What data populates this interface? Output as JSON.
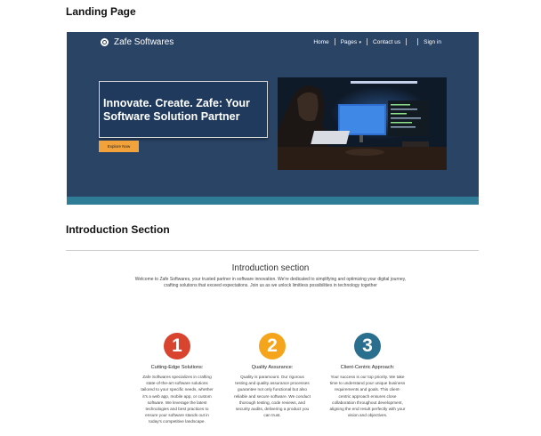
{
  "page": {
    "title": "Landing Page"
  },
  "hero": {
    "brand": "Zafe Softwares",
    "nav": {
      "home": "Home",
      "pages": "Pages",
      "contact": "Contact us",
      "signin": "Sign in"
    },
    "headline": "Innovate. Create. Zafe: Your Software Solution Partner",
    "cta": "Explore Now",
    "image_icon": "workspace-photo",
    "colors": {
      "background": "#2a4466",
      "strip": "#2f7c97",
      "cta": "#f2a23a"
    }
  },
  "intro": {
    "heading": "Introduction Section",
    "subheading": "Introduction section",
    "text": "Welcome to Zafe Softwares, your trusted partner in software innovation. We're dedicated to simplifying and optimizing your digital journey, crafting solutions that exceed expectations. Join us as we unlock limitless possibilities in technology together"
  },
  "features": [
    {
      "number": "1",
      "color": "#d9442e",
      "title": "Cutting-Edge Solutions:",
      "text": "Zafe Softwares specializes in crafting state-of-the-art software solutions tailored to your specific needs, whether it's a web app, mobile app, or custom software. We leverage the latest technologies and best practices to ensure your software stands out in today's competitive landscape."
    },
    {
      "number": "2",
      "color": "#f5a51c",
      "title": "Quality Assurance:",
      "text": "Quality is paramount. Our rigorous testing and quality assurance processes guarantee not only functional but also reliable and secure software. We conduct thorough testing, code reviews, and security audits, delivering a product you can trust."
    },
    {
      "number": "3",
      "color": "#2a6f8e",
      "title": "Client-Centric Approach:",
      "text": "Your success is our top priority. We take time to understand your unique business requirements and goals. This client-centric approach ensures close collaboration throughout development, aligning the end result perfectly with your vision and objectives."
    }
  ]
}
